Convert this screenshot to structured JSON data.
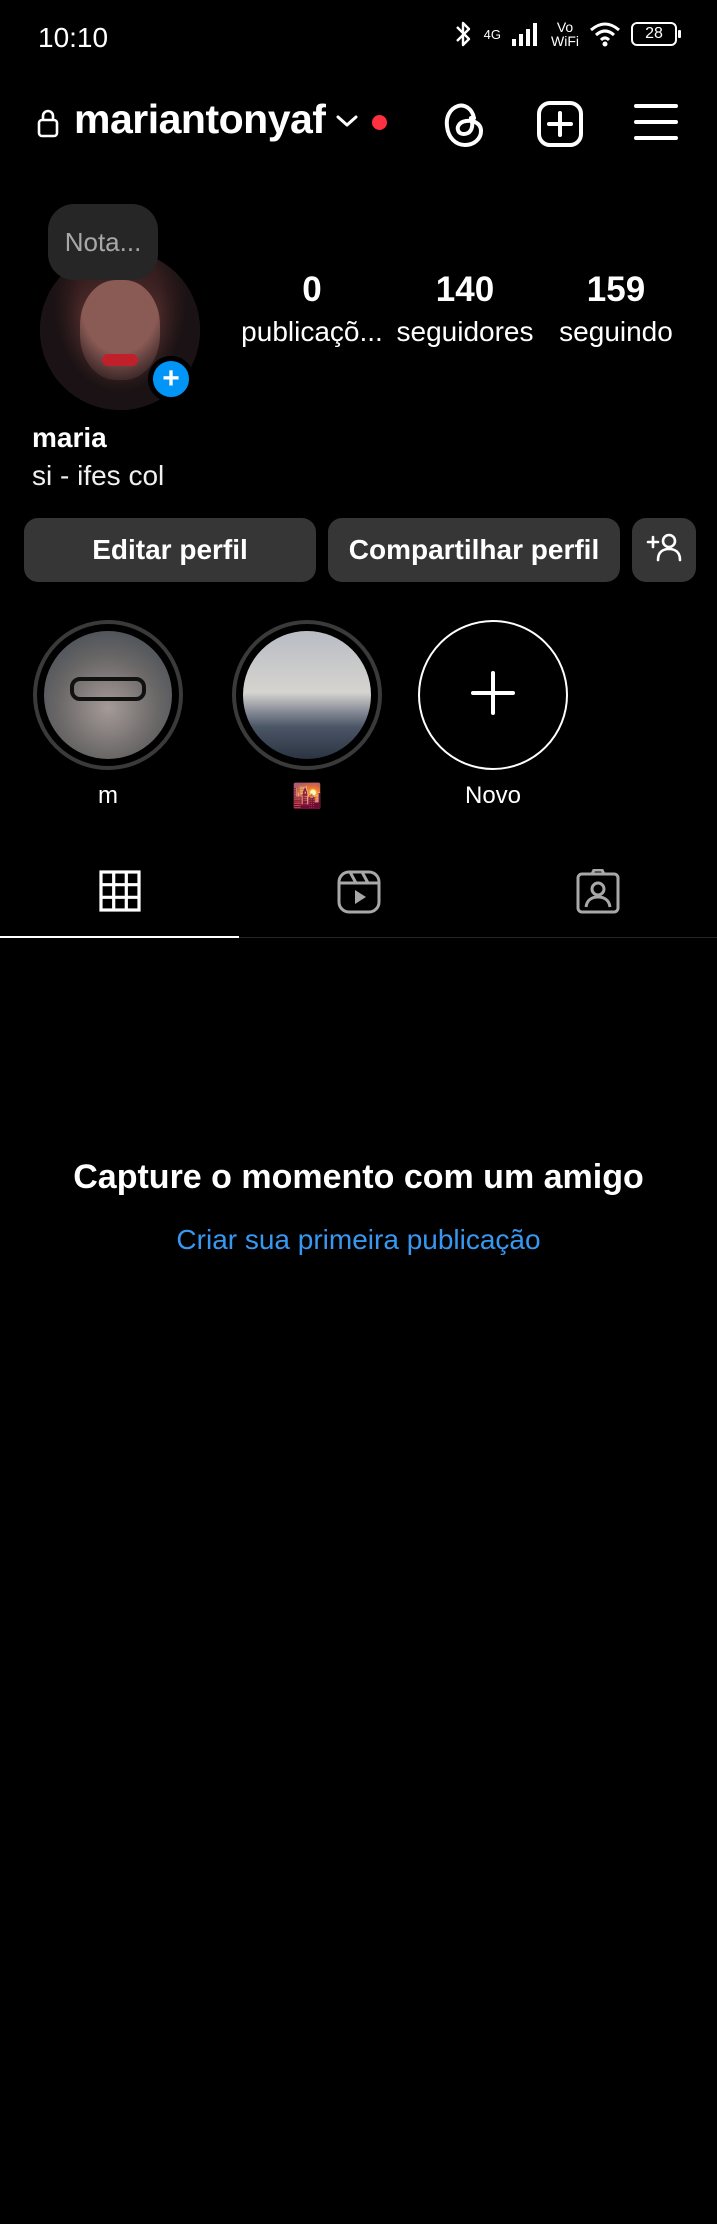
{
  "status_bar": {
    "time": "10:10",
    "network_label": "4G",
    "vowifi_top": "Vo",
    "vowifi_bottom": "WiFi",
    "battery": "28",
    "icons": [
      "bluetooth-icon",
      "signal-icon",
      "wifi-icon",
      "battery-icon"
    ]
  },
  "header": {
    "username": "mariantonyaf",
    "icons": [
      "lock-icon",
      "chevron-down-icon",
      "threads-icon",
      "create-icon",
      "menu-icon"
    ],
    "notification_dot_color": "#ff3040"
  },
  "profile": {
    "note": "Nota...",
    "add_story": "+",
    "stats": {
      "posts_value": "0",
      "posts_label": "publicaçõ...",
      "followers_value": "140",
      "followers_label": "seguidores",
      "following_value": "159",
      "following_label": "seguindo"
    },
    "name": "maria",
    "bio": "si - ifes col"
  },
  "actions": {
    "edit_label": "Editar perfil",
    "share_label": "Compartilhar perfil"
  },
  "highlights": [
    {
      "label": "m"
    },
    {
      "label": "🌇"
    },
    {
      "label": "Novo"
    }
  ],
  "tabs": [
    "grid-icon",
    "reels-icon",
    "tagged-icon"
  ],
  "empty_state": {
    "title": "Capture o momento com um amigo",
    "link": "Criar sua primeira publicação"
  },
  "colors": {
    "background": "#000000",
    "button": "#363636",
    "accent_blue": "#0095f6",
    "link_blue": "#3897f0"
  }
}
